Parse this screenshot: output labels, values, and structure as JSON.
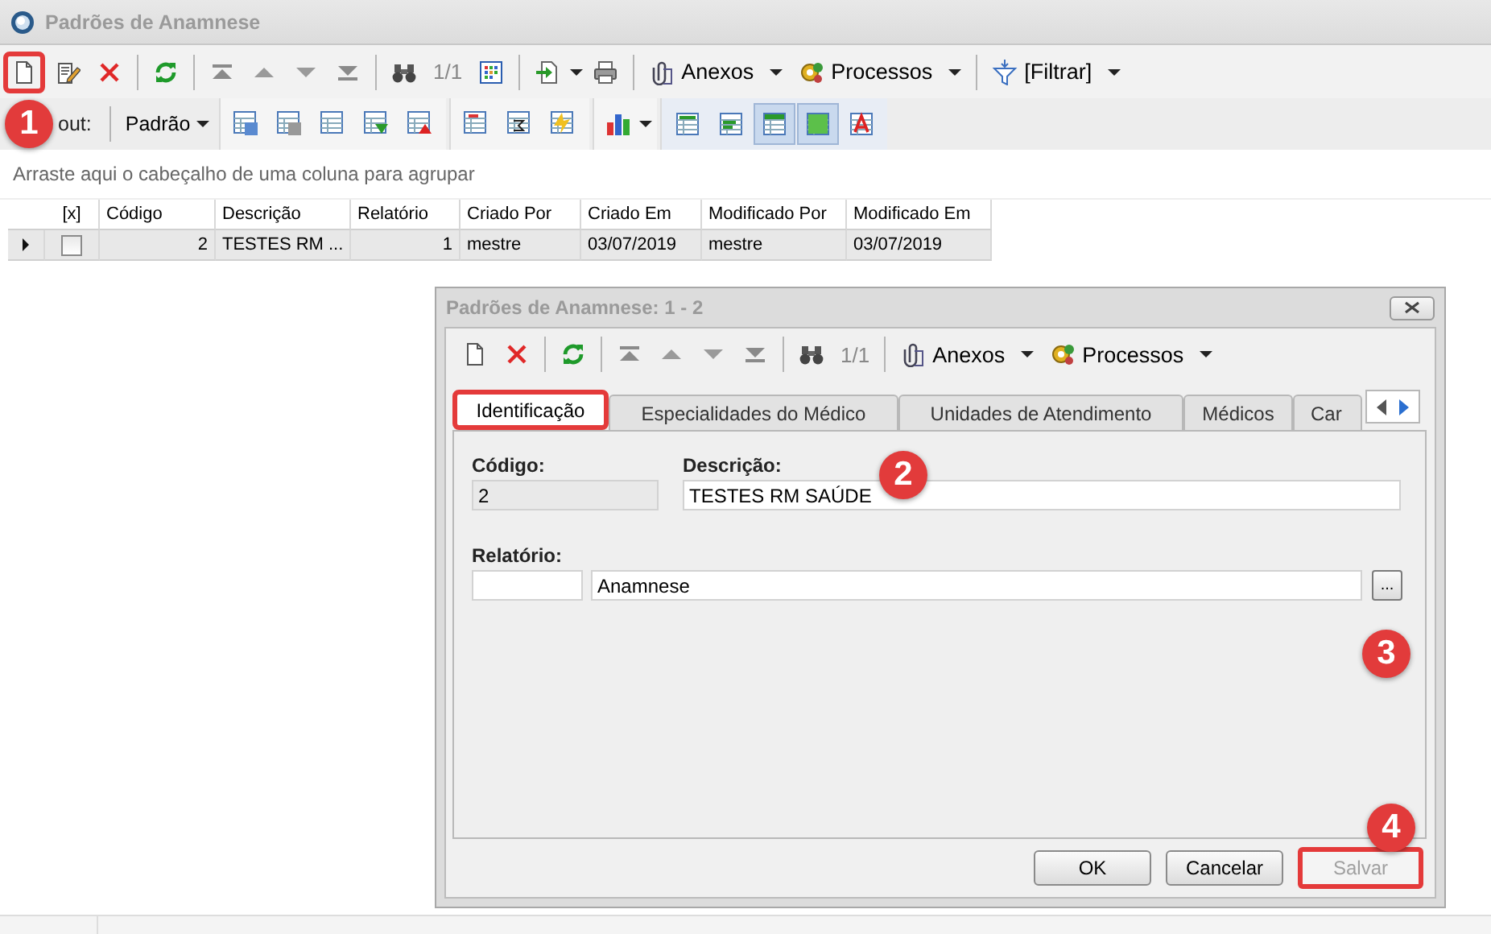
{
  "window": {
    "title": "Padrões de Anamnese"
  },
  "toolbar": {
    "new_highlighted": true,
    "record_counter": "1/1",
    "menus": [
      {
        "label": "Anexos"
      },
      {
        "label": "Processos"
      },
      {
        "label": "[Filtrar]"
      }
    ]
  },
  "layout_bar": {
    "label": "out:",
    "layout": "Padrão",
    "view_buttons": [
      {
        "pressed": false
      },
      {
        "pressed": false
      },
      {
        "pressed": true
      },
      {
        "pressed": true
      },
      {
        "pressed": false
      }
    ]
  },
  "group_hint": "Arraste aqui o cabeçalho de uma coluna para agrupar",
  "grid": {
    "checkbox_column": "[x]",
    "columns": [
      "Código",
      "Descrição",
      "Relatório",
      "Criado Por",
      "Criado Em",
      "Modificado Por",
      "Modificado Em"
    ],
    "rows": [
      {
        "current": true,
        "checked": false,
        "cells": [
          "2",
          "TESTES RM ...",
          "1",
          "mestre",
          "03/07/2019",
          "mestre",
          "03/07/2019"
        ]
      }
    ]
  },
  "dialog": {
    "title": "Padrões de Anamnese: 1 - 2",
    "toolbar": {
      "record_counter": "1/1",
      "menus": [
        {
          "label": "Anexos"
        },
        {
          "label": "Processos"
        }
      ]
    },
    "tabs": [
      {
        "label": "Identificação",
        "selected": true,
        "highlighted": true
      },
      {
        "label": "Especialidades do Médico",
        "selected": false,
        "highlighted": false
      },
      {
        "label": "Unidades de Atendimento",
        "selected": false,
        "highlighted": false
      },
      {
        "label": "Médicos",
        "selected": false,
        "highlighted": false
      },
      {
        "label": "Car",
        "selected": false,
        "highlighted": false
      }
    ],
    "form": {
      "codigo": {
        "label": "Código:",
        "value": "2",
        "disabled": true
      },
      "descricao": {
        "label": "Descrição:",
        "value": "TESTES RM SAÚDE",
        "disabled": false
      },
      "relatorio": {
        "label": "Relatório:",
        "name": "Anamnese",
        "browse": "..."
      }
    },
    "buttons": [
      {
        "label": "OK",
        "disabled": false,
        "highlighted": false
      },
      {
        "label": "Cancelar",
        "disabled": false,
        "highlighted": false
      },
      {
        "label": "Salvar",
        "disabled": true,
        "highlighted": true
      }
    ]
  },
  "callouts": [
    "1",
    "2",
    "3",
    "4"
  ]
}
